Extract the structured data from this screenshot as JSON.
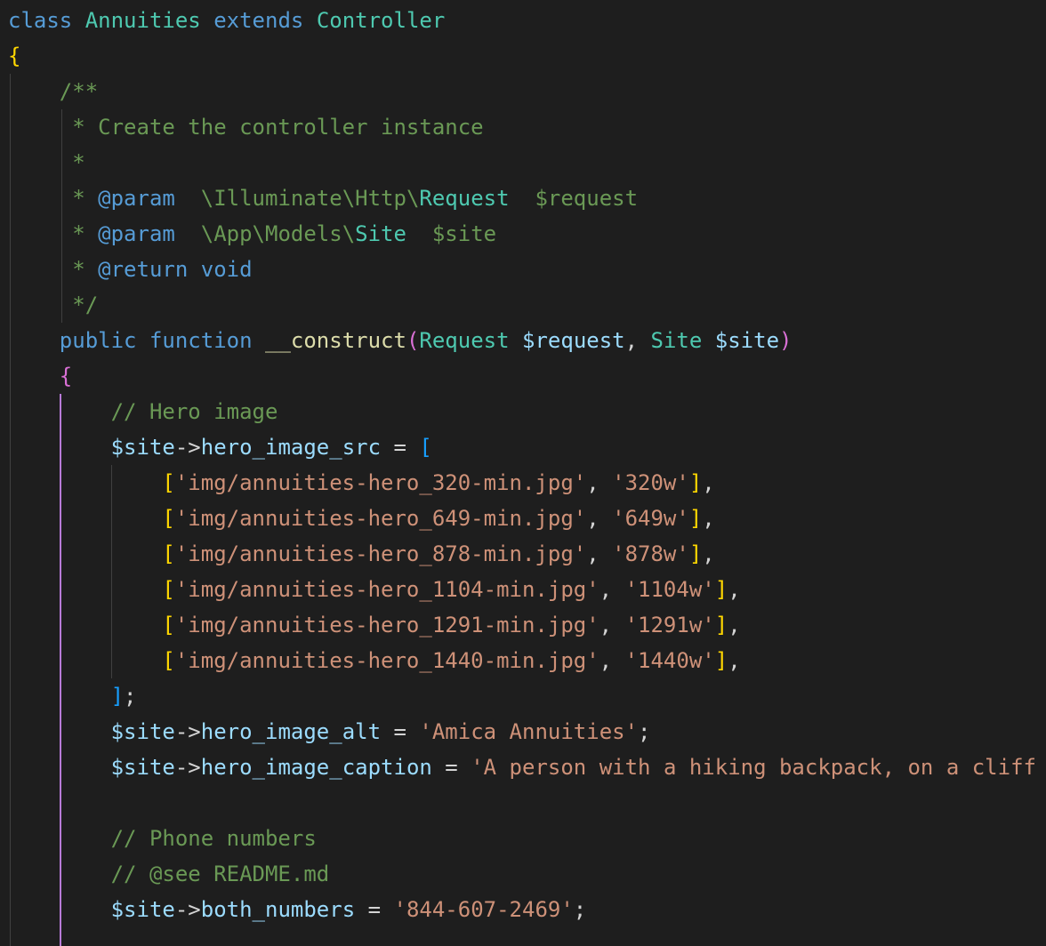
{
  "editor": {
    "colors": {
      "background": "#1e1e1e",
      "keyword": "#569cd6",
      "type": "#4ec9b0",
      "comment": "#6a9955",
      "variable": "#9cdcfe",
      "function": "#dcdcaa",
      "string": "#ce9178",
      "bracket_gold": "#ffd700",
      "bracket_purple": "#da70d6",
      "bracket_blue": "#179fff"
    },
    "lines": [
      [
        {
          "t": "class",
          "c": "kw"
        },
        {
          "t": " ",
          "c": "pn"
        },
        {
          "t": "Annuities",
          "c": "ty"
        },
        {
          "t": " ",
          "c": "pn"
        },
        {
          "t": "extends",
          "c": "kw"
        },
        {
          "t": " ",
          "c": "pn"
        },
        {
          "t": "Controller",
          "c": "ty"
        }
      ],
      [
        {
          "t": "{",
          "c": "br1"
        }
      ],
      [
        {
          "t": "    /**",
          "c": "cm"
        }
      ],
      [
        {
          "t": "     * Create the controller instance",
          "c": "cm"
        }
      ],
      [
        {
          "t": "     *",
          "c": "cm"
        }
      ],
      [
        {
          "t": "     * ",
          "c": "cm"
        },
        {
          "t": "@param",
          "c": "tag"
        },
        {
          "t": "  \\Illuminate\\Http\\",
          "c": "cm"
        },
        {
          "t": "Request",
          "c": "ty"
        },
        {
          "t": "  $request",
          "c": "cm"
        }
      ],
      [
        {
          "t": "     * ",
          "c": "cm"
        },
        {
          "t": "@param",
          "c": "tag"
        },
        {
          "t": "  \\App\\Models\\",
          "c": "cm"
        },
        {
          "t": "Site",
          "c": "ty"
        },
        {
          "t": "  $site",
          "c": "cm"
        }
      ],
      [
        {
          "t": "     * ",
          "c": "cm"
        },
        {
          "t": "@return",
          "c": "tag"
        },
        {
          "t": " ",
          "c": "cm"
        },
        {
          "t": "void",
          "c": "kw"
        }
      ],
      [
        {
          "t": "     */",
          "c": "cm"
        }
      ],
      [
        {
          "t": "    ",
          "c": "pn"
        },
        {
          "t": "public",
          "c": "kw"
        },
        {
          "t": " ",
          "c": "pn"
        },
        {
          "t": "function",
          "c": "kw"
        },
        {
          "t": " ",
          "c": "pn"
        },
        {
          "t": "__construct",
          "c": "fn"
        },
        {
          "t": "(",
          "c": "br2"
        },
        {
          "t": "Request",
          "c": "ty"
        },
        {
          "t": " ",
          "c": "pn"
        },
        {
          "t": "$request",
          "c": "var"
        },
        {
          "t": ", ",
          "c": "pn"
        },
        {
          "t": "Site",
          "c": "ty"
        },
        {
          "t": " ",
          "c": "pn"
        },
        {
          "t": "$site",
          "c": "var"
        },
        {
          "t": ")",
          "c": "br2"
        }
      ],
      [
        {
          "t": "    ",
          "c": "pn"
        },
        {
          "t": "{",
          "c": "br2"
        }
      ],
      [
        {
          "t": "        // Hero image",
          "c": "cm"
        }
      ],
      [
        {
          "t": "        ",
          "c": "pn"
        },
        {
          "t": "$site",
          "c": "var"
        },
        {
          "t": "->",
          "c": "pn"
        },
        {
          "t": "hero_image_src",
          "c": "var"
        },
        {
          "t": " = ",
          "c": "pn"
        },
        {
          "t": "[",
          "c": "br3"
        }
      ],
      [
        {
          "t": "            ",
          "c": "pn"
        },
        {
          "t": "[",
          "c": "br1"
        },
        {
          "t": "'img/annuities-hero_320-min.jpg'",
          "c": "str"
        },
        {
          "t": ", ",
          "c": "pn"
        },
        {
          "t": "'320w'",
          "c": "str"
        },
        {
          "t": "]",
          "c": "br1"
        },
        {
          "t": ",",
          "c": "pn"
        }
      ],
      [
        {
          "t": "            ",
          "c": "pn"
        },
        {
          "t": "[",
          "c": "br1"
        },
        {
          "t": "'img/annuities-hero_649-min.jpg'",
          "c": "str"
        },
        {
          "t": ", ",
          "c": "pn"
        },
        {
          "t": "'649w'",
          "c": "str"
        },
        {
          "t": "]",
          "c": "br1"
        },
        {
          "t": ",",
          "c": "pn"
        }
      ],
      [
        {
          "t": "            ",
          "c": "pn"
        },
        {
          "t": "[",
          "c": "br1"
        },
        {
          "t": "'img/annuities-hero_878-min.jpg'",
          "c": "str"
        },
        {
          "t": ", ",
          "c": "pn"
        },
        {
          "t": "'878w'",
          "c": "str"
        },
        {
          "t": "]",
          "c": "br1"
        },
        {
          "t": ",",
          "c": "pn"
        }
      ],
      [
        {
          "t": "            ",
          "c": "pn"
        },
        {
          "t": "[",
          "c": "br1"
        },
        {
          "t": "'img/annuities-hero_1104-min.jpg'",
          "c": "str"
        },
        {
          "t": ", ",
          "c": "pn"
        },
        {
          "t": "'1104w'",
          "c": "str"
        },
        {
          "t": "]",
          "c": "br1"
        },
        {
          "t": ",",
          "c": "pn"
        }
      ],
      [
        {
          "t": "            ",
          "c": "pn"
        },
        {
          "t": "[",
          "c": "br1"
        },
        {
          "t": "'img/annuities-hero_1291-min.jpg'",
          "c": "str"
        },
        {
          "t": ", ",
          "c": "pn"
        },
        {
          "t": "'1291w'",
          "c": "str"
        },
        {
          "t": "]",
          "c": "br1"
        },
        {
          "t": ",",
          "c": "pn"
        }
      ],
      [
        {
          "t": "            ",
          "c": "pn"
        },
        {
          "t": "[",
          "c": "br1"
        },
        {
          "t": "'img/annuities-hero_1440-min.jpg'",
          "c": "str"
        },
        {
          "t": ", ",
          "c": "pn"
        },
        {
          "t": "'1440w'",
          "c": "str"
        },
        {
          "t": "]",
          "c": "br1"
        },
        {
          "t": ",",
          "c": "pn"
        }
      ],
      [
        {
          "t": "        ",
          "c": "pn"
        },
        {
          "t": "]",
          "c": "br3"
        },
        {
          "t": ";",
          "c": "pn"
        }
      ],
      [
        {
          "t": "        ",
          "c": "pn"
        },
        {
          "t": "$site",
          "c": "var"
        },
        {
          "t": "->",
          "c": "pn"
        },
        {
          "t": "hero_image_alt",
          "c": "var"
        },
        {
          "t": " = ",
          "c": "pn"
        },
        {
          "t": "'Amica Annuities'",
          "c": "str"
        },
        {
          "t": ";",
          "c": "pn"
        }
      ],
      [
        {
          "t": "        ",
          "c": "pn"
        },
        {
          "t": "$site",
          "c": "var"
        },
        {
          "t": "->",
          "c": "pn"
        },
        {
          "t": "hero_image_caption",
          "c": "var"
        },
        {
          "t": " = ",
          "c": "pn"
        },
        {
          "t": "'A person with a hiking backpack, on a cliff",
          "c": "str"
        }
      ],
      [],
      [
        {
          "t": "        // Phone numbers",
          "c": "cm"
        }
      ],
      [
        {
          "t": "        // @see README.md",
          "c": "cm"
        }
      ],
      [
        {
          "t": "        ",
          "c": "pn"
        },
        {
          "t": "$site",
          "c": "var"
        },
        {
          "t": "->",
          "c": "pn"
        },
        {
          "t": "both_numbers",
          "c": "var"
        },
        {
          "t": " = ",
          "c": "pn"
        },
        {
          "t": "'844-607-2469'",
          "c": "str"
        },
        {
          "t": ";",
          "c": "pn"
        }
      ]
    ]
  }
}
